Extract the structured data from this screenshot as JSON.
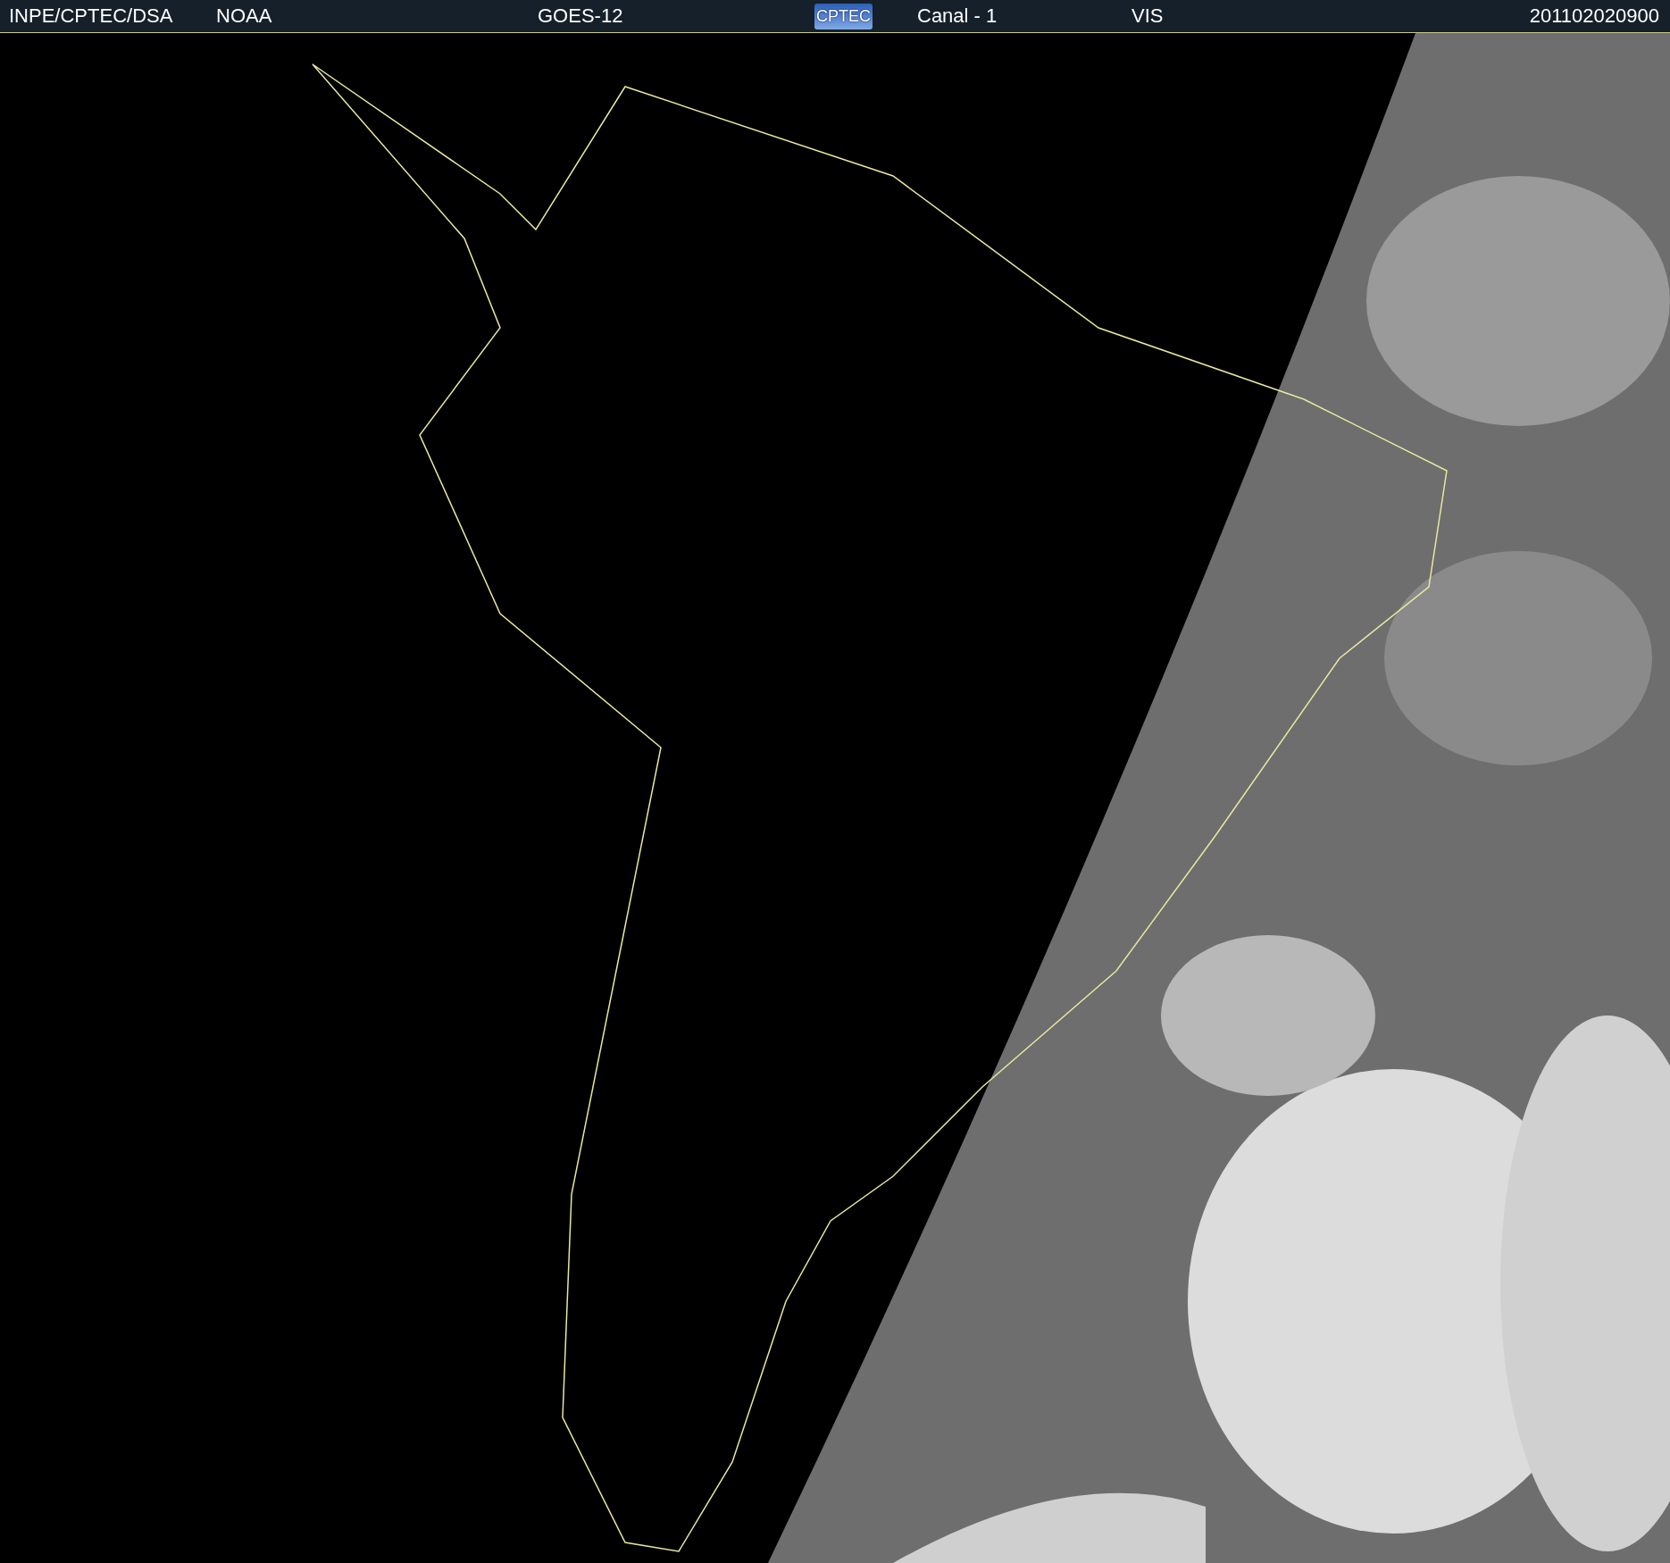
{
  "header": {
    "items": [
      {
        "kind": "text",
        "text": "INPE/CPTEC/DSA"
      },
      {
        "kind": "text",
        "text": "NOAA"
      },
      {
        "kind": "text",
        "text": "GOES-12"
      },
      {
        "kind": "logo",
        "text": "CPTEC"
      },
      {
        "kind": "text",
        "text": "Canal - 1"
      },
      {
        "kind": "text",
        "text": "VIS"
      },
      {
        "kind": "text",
        "text": "201102020900"
      }
    ]
  }
}
